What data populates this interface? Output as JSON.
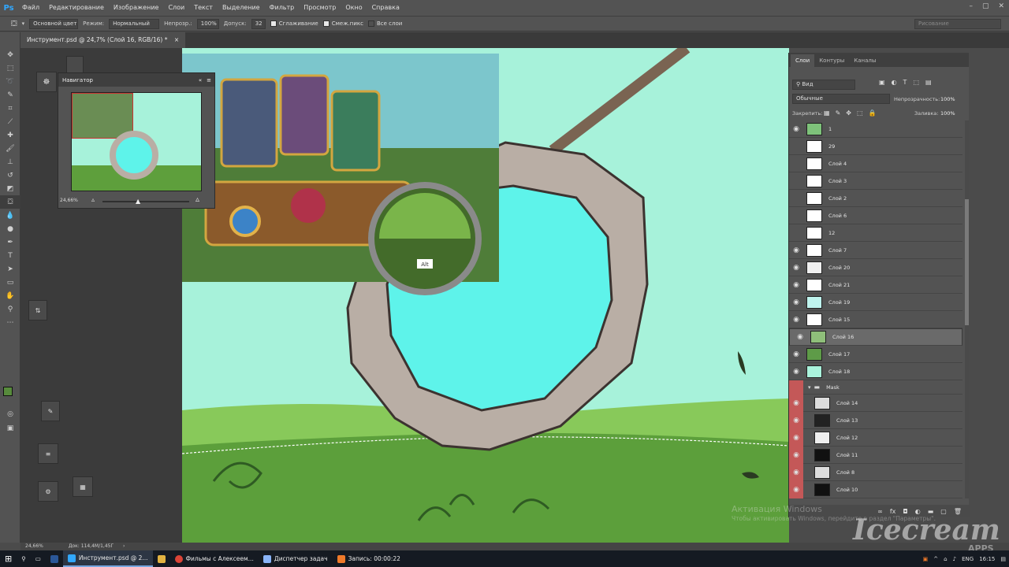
{
  "app": {
    "logo": "Ps"
  },
  "menu": [
    "Файл",
    "Редактирование",
    "Изображение",
    "Слои",
    "Текст",
    "Выделение",
    "Фильтр",
    "Просмотр",
    "Окно",
    "Справка"
  ],
  "window_controls": [
    "–",
    "▢",
    "✕"
  ],
  "options": {
    "preset": "Основной цвет",
    "mode_label": "Режим:",
    "mode_value": "Нормальный",
    "opacity_label": "Непрозр.:",
    "opacity_value": "100%",
    "tolerance_label": "Допуск:",
    "tolerance_value": "32",
    "antialias": "Сглаживание",
    "contiguous": "Смеж.пикс",
    "all_layers": "Все слои",
    "workspace": "Рисование"
  },
  "document_tab": "Инструмент.psd @ 24,7% (Слой 16, RGB/16) *",
  "navigator": {
    "title": "Навигатор",
    "zoom": "24,66%"
  },
  "color_picker_tip": "Alt",
  "layers_panel": {
    "tabs": [
      "Слои",
      "Контуры",
      "Каналы"
    ],
    "kind_filter": "Вид",
    "blend_mode": "Обычные",
    "opacity_label": "Непрозрачность:",
    "opacity_value": "100%",
    "lock_label": "Закрепить:",
    "fill_label": "Заливка:",
    "fill_value": "100%",
    "layers": [
      {
        "name": "1",
        "visible": true,
        "thumb": "#7ec27a"
      },
      {
        "name": "29",
        "visible": false,
        "thumb": "#ffffff"
      },
      {
        "name": "Слой 4",
        "visible": false,
        "thumb": "#ffffff"
      },
      {
        "name": "Слой 3",
        "visible": false,
        "thumb": "#ffffff"
      },
      {
        "name": "Слой 2",
        "visible": false,
        "thumb": "#ffffff"
      },
      {
        "name": "Слой 6",
        "visible": false,
        "thumb": "#ffffff"
      },
      {
        "name": "12",
        "visible": false,
        "thumb": "#ffffff"
      },
      {
        "name": "Слой 7",
        "visible": true,
        "thumb": "#ffffff"
      },
      {
        "name": "Слой 20",
        "visible": true,
        "thumb": "#f0f0f0"
      },
      {
        "name": "Слой 21",
        "visible": true,
        "thumb": "#ffffff"
      },
      {
        "name": "Слой 19",
        "visible": true,
        "thumb": "#bff4ee"
      },
      {
        "name": "Слой 15",
        "visible": true,
        "thumb": "#ffffff"
      },
      {
        "name": "Слой 16",
        "visible": true,
        "thumb": "#8fbf7a",
        "selected": true
      },
      {
        "name": "Слой 17",
        "visible": true,
        "thumb": "#5e9b48"
      },
      {
        "name": "Слой 18",
        "visible": true,
        "thumb": "#aaf3dc"
      }
    ],
    "group": {
      "name": "Mask"
    },
    "mask_layers": [
      {
        "name": "Слой 14",
        "thumb": "#dddddd"
      },
      {
        "name": "Слой 13",
        "thumb": "#222222"
      },
      {
        "name": "Слой 12",
        "thumb": "#eeeeee"
      },
      {
        "name": "Слой 11",
        "thumb": "#111111"
      },
      {
        "name": "Слой 8",
        "thumb": "#dddddd"
      },
      {
        "name": "Слой 10",
        "thumb": "#111111"
      }
    ]
  },
  "status": {
    "zoom": "24,66%",
    "doc": "Док: 114,4M/1,45Г"
  },
  "taskbar": {
    "items": [
      {
        "label": "Инструмент.psd @ 2...",
        "color": "#31a8ff",
        "active": true
      },
      {
        "label": "",
        "color": "#e3b341"
      },
      {
        "label": "Фильмы с Алексеем...",
        "color": "#db4437"
      },
      {
        "label": "Диспетчер задач",
        "color": "#8ab4f8"
      },
      {
        "label": "Запись: 00:00:22",
        "color": "#f07a2a"
      }
    ],
    "lang": "ENG",
    "time": "16:15"
  },
  "watermark": {
    "line1": "Активация Windows",
    "line2": "Чтобы активировать Windows, перейдите в раздел \"Параметры\".",
    "brand": "Icecream",
    "brand_sub": "APPS"
  },
  "colors": {
    "sky": "#a7f2da",
    "hole": "#5ef3ea",
    "grass": "#76b84a",
    "ring": "#b9aea5",
    "fg": "#578b3c",
    "bg": "#ffffff"
  }
}
